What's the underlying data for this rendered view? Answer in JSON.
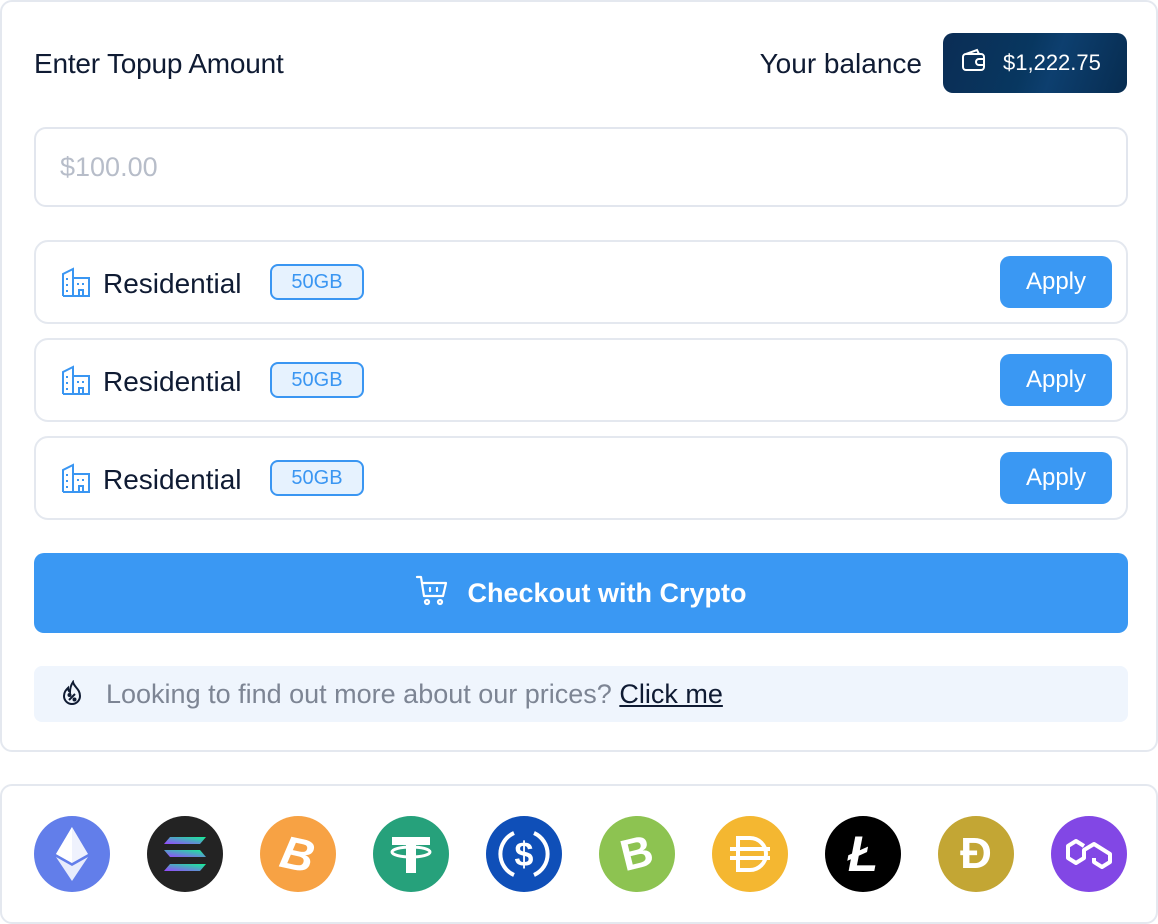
{
  "topup": {
    "title": "Enter Topup Amount",
    "balance_label": "Your balance",
    "balance_value": "$1,222.75",
    "amount_placeholder": "$100.00"
  },
  "plans": [
    {
      "name": "Residential",
      "badge": "50GB",
      "apply_label": "Apply"
    },
    {
      "name": "Residential",
      "badge": "50GB",
      "apply_label": "Apply"
    },
    {
      "name": "Residential",
      "badge": "50GB",
      "apply_label": "Apply"
    }
  ],
  "checkout": {
    "label": "Checkout with Crypto",
    "icon": "cart-icon"
  },
  "info": {
    "text": "Looking to find out more about our prices?",
    "link": "Click me",
    "icon": "flame-discount-icon"
  },
  "colors": {
    "accent": "#3a98f3",
    "balance_bg": "#0b2d55",
    "text": "#0f1b33",
    "muted": "#7d8594"
  },
  "coins": [
    {
      "name": "ethereum-icon",
      "color": "#627eea"
    },
    {
      "name": "solana-icon",
      "color": "#232323"
    },
    {
      "name": "bitcoin-icon",
      "color": "#f7a244"
    },
    {
      "name": "tether-icon",
      "color": "#26a17b"
    },
    {
      "name": "usd-coin-icon",
      "color": "#0f4fb8"
    },
    {
      "name": "bitcoin-cash-icon",
      "color": "#8dc351"
    },
    {
      "name": "dai-icon",
      "color": "#f4b731"
    },
    {
      "name": "litecoin-icon",
      "color": "#000000"
    },
    {
      "name": "dogecoin-icon",
      "color": "#c3a634"
    },
    {
      "name": "polygon-icon",
      "color": "#8247e5"
    }
  ]
}
